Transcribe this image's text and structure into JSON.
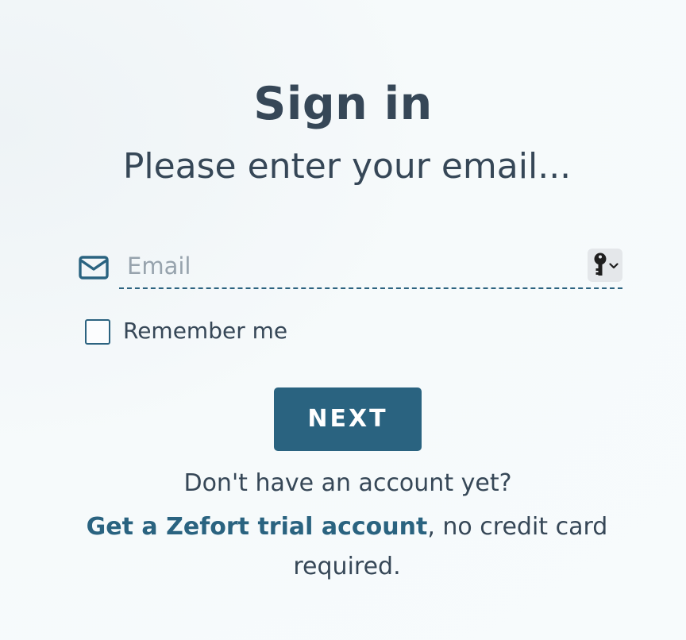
{
  "header": {
    "title": "Sign in",
    "subtitle": "Please enter your email..."
  },
  "form": {
    "email_placeholder": "Email",
    "email_value": "",
    "remember_label": "Remember me",
    "remember_checked": false,
    "next_label": "NEXT"
  },
  "footer": {
    "question": "Don't have an account yet?",
    "trial_link": "Get a Zefort trial account",
    "trial_suffix": ", no credit card required."
  },
  "icons": {
    "email": "envelope-icon",
    "password_manager": "key-icon",
    "dropdown": "chevron-down-icon"
  },
  "colors": {
    "accent": "#2a6380",
    "text": "#364757",
    "placeholder": "#97a3ad",
    "background": "#f6fafb"
  }
}
